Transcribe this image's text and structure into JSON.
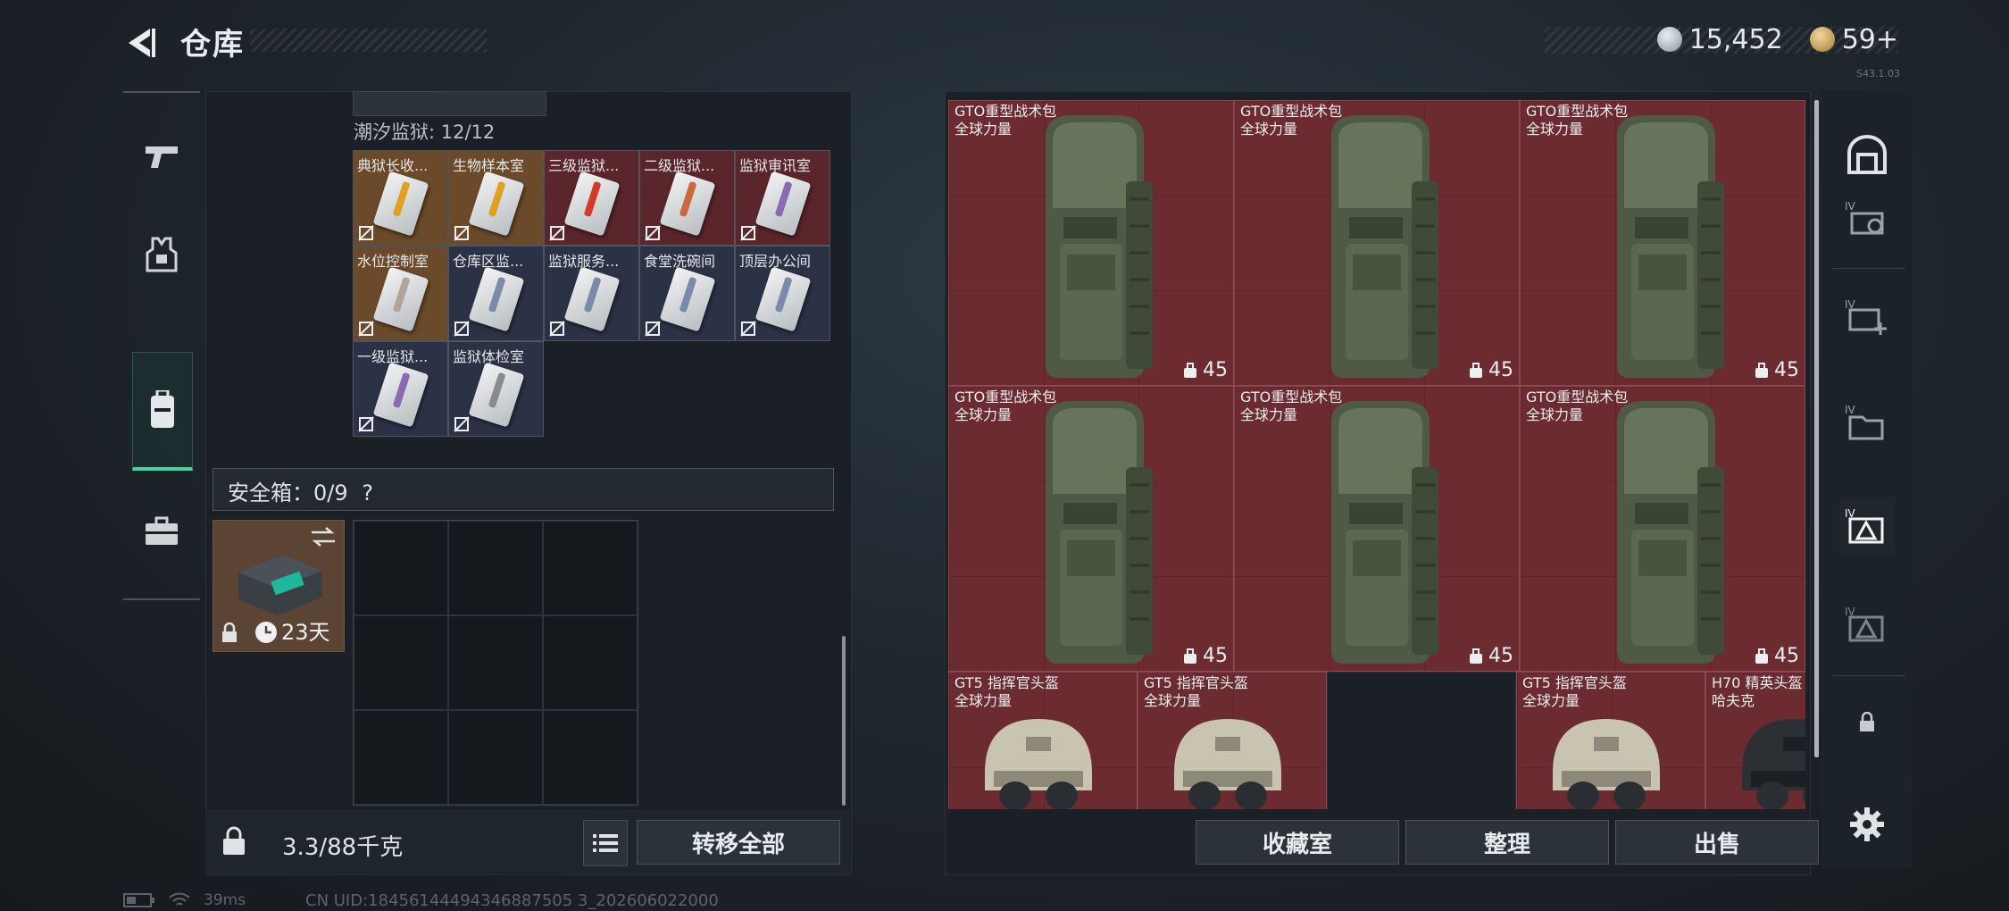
{
  "header": {
    "title": "仓库",
    "silver": "15,452",
    "gold": "59+",
    "version": "S43.1.03"
  },
  "inventory": {
    "region_label": "潮汐监狱: 12/12",
    "keys": [
      {
        "name": "典狱长收...",
        "tone": "gold",
        "accent": "#e0a020"
      },
      {
        "name": "生物样本室",
        "tone": "gold",
        "accent": "#e0a020"
      },
      {
        "name": "三级监狱...",
        "tone": "red",
        "accent": "#d23a2a"
      },
      {
        "name": "二级监狱...",
        "tone": "red",
        "accent": "#c96a3a"
      },
      {
        "name": "监狱审讯室",
        "tone": "red",
        "accent": "#8a6ab0"
      },
      {
        "name": "水位控制室",
        "tone": "gold",
        "accent": "#b0a59a"
      },
      {
        "name": "仓库区监...",
        "tone": "blue",
        "accent": "#7a8aa8"
      },
      {
        "name": "监狱服务...",
        "tone": "blue",
        "accent": "#7a8aa8"
      },
      {
        "name": "食堂洗碗间",
        "tone": "blue",
        "accent": "#7a8aa8"
      },
      {
        "name": "顶层办公间",
        "tone": "blue",
        "accent": "#7a8aa8"
      },
      {
        "name": "一级监狱...",
        "tone": "blue",
        "accent": "#8a6ab0"
      },
      {
        "name": "监狱体检室",
        "tone": "blue",
        "accent": "#8a8a8a"
      }
    ],
    "safe_box": {
      "label": "安全箱：0/9",
      "help": "?",
      "duration": "23天"
    },
    "weight": "3.3/88千克",
    "transfer_all": "转移全部"
  },
  "storage": {
    "backpacks": [
      {
        "name": "GTO重型战术包",
        "sub": "全球力量",
        "count": "45"
      },
      {
        "name": "GTO重型战术包",
        "sub": "全球力量",
        "count": "45"
      },
      {
        "name": "GTO重型战术包",
        "sub": "全球力量",
        "count": "45"
      },
      {
        "name": "GTO重型战术包",
        "sub": "全球力量",
        "count": "45"
      },
      {
        "name": "GTO重型战术包",
        "sub": "全球力量",
        "count": "45"
      },
      {
        "name": "GTO重型战术包",
        "sub": "全球力量",
        "count": "45"
      }
    ],
    "helmets": [
      {
        "name": "GT5 指挥官头盔",
        "sub": "全球力量"
      },
      {
        "name": "GT5 指挥官头盔",
        "sub": "全球力量"
      },
      {
        "name": "GT5 指挥官头盔",
        "sub": "全球力量"
      },
      {
        "name": "H70 精英头盔",
        "sub": "哈夫克"
      }
    ],
    "buttons": {
      "collection": "收藏室",
      "sort": "整理",
      "sell": "出售"
    }
  },
  "status_bar": {
    "ping": "39ms",
    "uid": "CN UID:18456144494346887505 3_202606022000"
  },
  "colors": {
    "accent": "#3fd79e",
    "item_bg": "#6c2a31"
  }
}
